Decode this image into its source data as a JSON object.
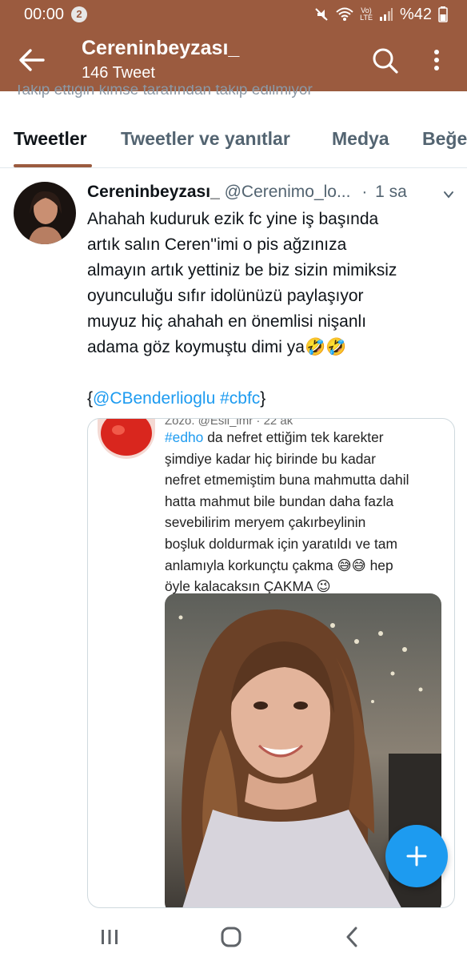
{
  "status_bar": {
    "time": "00:00",
    "notification_count": "2",
    "lte_label_top": "Vo)",
    "lte_label_bottom": "LTE",
    "battery": "%42"
  },
  "header": {
    "title": "Cereninbeyzası_",
    "subtitle": "146 Tweet",
    "clipped_text": "Takip ettiğin kimse tarafından takip edilmiyor",
    "color": "#9b5b3f"
  },
  "tabs": [
    {
      "label": "Tweetler",
      "active": true
    },
    {
      "label": "Tweetler ve yanıtlar",
      "active": false
    },
    {
      "label": "Medya",
      "active": false
    },
    {
      "label": "Beğe",
      "active": false
    }
  ],
  "tweet": {
    "name": "Cereninbeyzası_",
    "handle": "@Cerenimo_lo...",
    "dot": "·",
    "time": "1 sa",
    "body": "Ahahah kuduruk ezik fc yine iş başında\nartık salın Ceren''imi o pis ağzınıza\nalmayın artık yettiniz be biz sizin mimiksiz\noyunculuğu sıfır idolünüzü paylaşıyor\nmuyuz hiç ahahah en önemlisi nişanlı\nadama göz koymuştu dimi ya🤣🤣",
    "links_open": "{",
    "mention": "@CBenderlioglu",
    "hashtag": "#cbfc",
    "links_close": "}"
  },
  "embedded": {
    "top_clipped": "Zozo.  @Esii_lmr · 22 ak",
    "hashtag": "#edho",
    "first_line_rest": " da nefret ettiğim tek karekter",
    "lines": [
      "şimdiye kadar hiç birinde bu kadar",
      "nefret etmemiştim buna mahmutta dahil",
      "hatta mahmut bile bundan daha fazla",
      "sevebilirim  meryem çakırbeylinin",
      "boşluk doldurmak için yaratıldı ve tam",
      "anlamıyla korkunçtu çakma 😅😅 hep",
      "öyle kalacaksın ÇAKMA 😉"
    ]
  },
  "icons": {
    "back": "arrow-left-icon",
    "search": "search-icon",
    "more": "more-vertical-icon",
    "compose": "plus-icon",
    "accent": "#1d9bf0"
  }
}
